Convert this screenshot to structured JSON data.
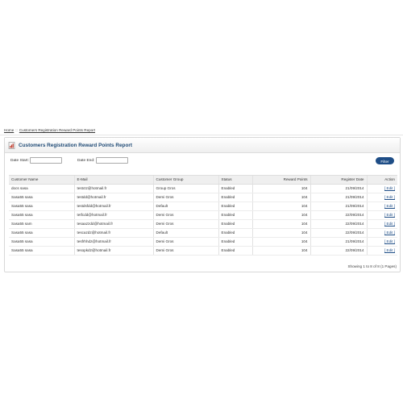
{
  "breadcrumb": {
    "home": "Home",
    "current": "Customers Registration Reward Points Report"
  },
  "panel": {
    "title": "Customers Registration Reward Points Report"
  },
  "filter": {
    "date_start_label": "Date Start:",
    "date_start_value": "",
    "date_end_label": "Date End:",
    "date_end_value": "",
    "button_label": "Filter"
  },
  "table": {
    "headers": [
      "Customer Name",
      "E-Mail",
      "Customer Group",
      "Status",
      "Reward Points",
      "Register Date",
      "Action"
    ],
    "rows": [
      {
        "name": "docs sasa",
        "email": "testctz@hotmail.fr",
        "group": "Group Gros",
        "status": "Enabled",
        "points": "104",
        "date": "21/09/2014",
        "action": "[ Edit ]"
      },
      {
        "name": "Sasa55 sasa",
        "email": "testdd@hotmail.fr",
        "group": "Demi Gros",
        "status": "Enabled",
        "points": "104",
        "date": "21/09/2014",
        "action": "[ Edit ]"
      },
      {
        "name": "Sasa55 sasa",
        "email": "testdsfdd@hotmail.fr",
        "group": "Default",
        "status": "Enabled",
        "points": "104",
        "date": "21/09/2014",
        "action": "[ Edit ]"
      },
      {
        "name": "Sasa55 sasa",
        "email": "tetfcdd@hotmail.fr",
        "group": "Demi Gros",
        "status": "Enabled",
        "points": "104",
        "date": "22/09/2014",
        "action": "[ Edit ]"
      },
      {
        "name": "Sasa55 sam",
        "email": "tesaazzdd@hotmail.fr",
        "group": "Demi Gros",
        "status": "Enabled",
        "points": "104",
        "date": "22/09/2014",
        "action": "[ Edit ]"
      },
      {
        "name": "Sasa55 sasa",
        "email": "tescazdz@hotmail.fr",
        "group": "Default",
        "status": "Enabled",
        "points": "104",
        "date": "22/09/2014",
        "action": "[ Edit ]"
      },
      {
        "name": "Sasa55 sasa",
        "email": "tesfrhhdz@hotmail.fr",
        "group": "Demi Gros",
        "status": "Enabled",
        "points": "104",
        "date": "21/09/2014",
        "action": "[ Edit ]"
      },
      {
        "name": "Sasa55 sasa",
        "email": "tesopkdz@hotmail.fr",
        "group": "Demi Gros",
        "status": "Enabled",
        "points": "104",
        "date": "22/09/2014",
        "action": "[ Edit ]"
      }
    ]
  },
  "pagination": {
    "text": "Showing 1 to 8 of 8 (1 Pages)"
  },
  "icons": {
    "report": "report-icon"
  },
  "colors": {
    "title": "#1f4a75",
    "button": "#1e4d86"
  }
}
